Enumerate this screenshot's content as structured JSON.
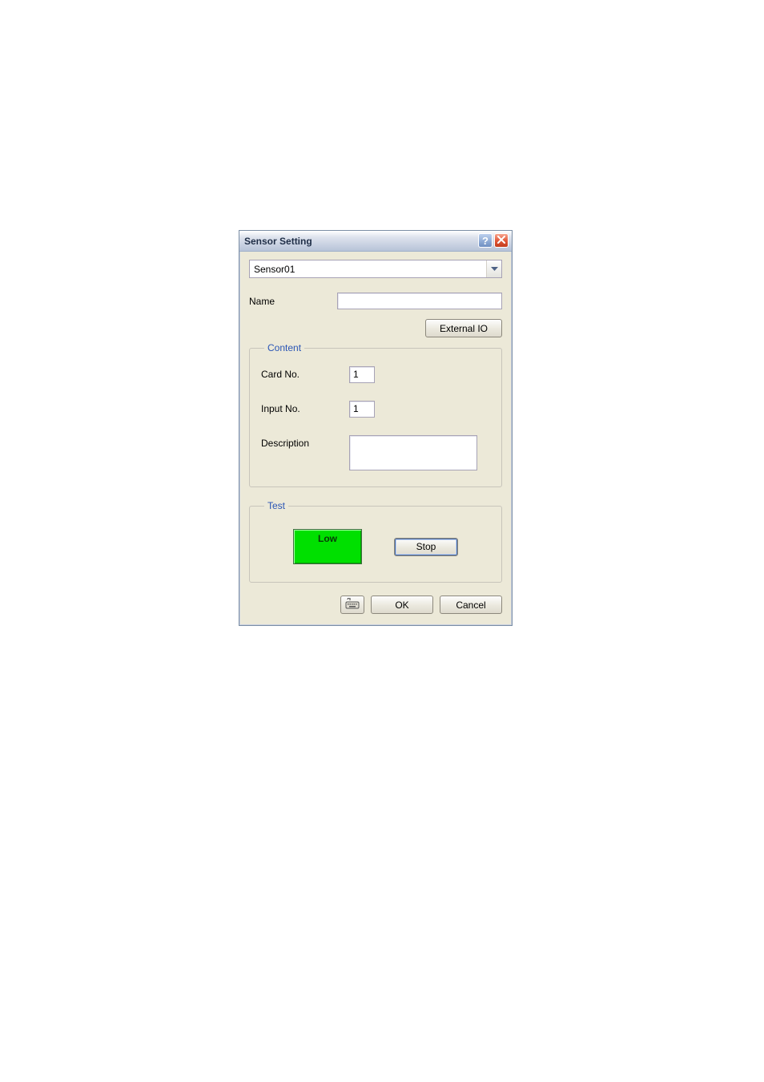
{
  "dialog": {
    "title": "Sensor Setting",
    "sensor_select": {
      "value": "Sensor01"
    },
    "name": {
      "label": "Name",
      "value": ""
    },
    "external_io_button": "External IO",
    "content_group": {
      "legend": "Content",
      "card_no": {
        "label": "Card No.",
        "value": "1"
      },
      "input_no": {
        "label": "Input No.",
        "value": "1"
      },
      "description": {
        "label": "Description",
        "value": ""
      }
    },
    "test_group": {
      "legend": "Test",
      "status": "Low",
      "stop_button": "Stop"
    },
    "footer": {
      "ok": "OK",
      "cancel": "Cancel"
    }
  }
}
